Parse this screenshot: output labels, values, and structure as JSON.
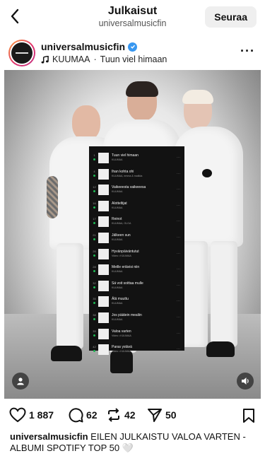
{
  "header": {
    "title": "Julkaisut",
    "subtitle": "universalmusicfin",
    "follow_label": "Seuraa"
  },
  "post": {
    "username": "universalmusicfin",
    "verified": true,
    "music_artist": "KUUMAA",
    "music_separator": "·",
    "music_track": "Tuun viel himaan"
  },
  "playlist": {
    "tracks": [
      {
        "num": "1",
        "title": "Tuun viel himaan",
        "sub": "KUUMAA"
      },
      {
        "num": "4",
        "title": "Ihan kohta ohi",
        "sub": "KUUMAA, emma & matilda"
      },
      {
        "num": "12",
        "title": "Vaikeeesta vaikeeesa",
        "sub": "KUUMAA"
      },
      {
        "num": "16",
        "title": "Alotteltijat",
        "sub": "KUUMAA"
      },
      {
        "num": "17",
        "title": "Reinot",
        "sub": "KUUMAA, OLGA"
      },
      {
        "num": "21",
        "title": "Jälkeen sun",
        "sub": "KUUMAA"
      },
      {
        "num": "26",
        "title": "Hyvänpäiväntutut",
        "sub": "Video • KUUMAA"
      },
      {
        "num": "28",
        "title": "Meille eriävisi niin",
        "sub": "KUUMAA"
      },
      {
        "num": "32",
        "title": "Sä voit soittaa mulle",
        "sub": "KUUMAA"
      },
      {
        "num": "35",
        "title": "Älä muuttu",
        "sub": "KUUMAA"
      },
      {
        "num": "38",
        "title": "Jos päätein mealiin",
        "sub": "KUUMAA"
      },
      {
        "num": "39",
        "title": "Valoa varten",
        "sub": "Video • KUUMAA"
      },
      {
        "num": "42",
        "title": "Paras ystävä",
        "sub": "Video • KUUMAA"
      }
    ],
    "more_glyph": "···"
  },
  "actions": {
    "likes": "1 887",
    "comments": "62",
    "reposts": "42",
    "shares": "50"
  },
  "caption": {
    "username": "universalmusicfin",
    "text": "EILEN JULKAISTU VALOA VARTEN -ALBUMI SPOTIFY TOP 50",
    "emoji": "🤍"
  },
  "icons": {
    "back": "chevron-left-icon",
    "more": "more-horizontal-icon",
    "music": "music-note-icon",
    "like": "heart-icon",
    "comment": "comment-icon",
    "repost": "repost-icon",
    "share": "send-icon",
    "save": "bookmark-icon",
    "user_tag": "person-icon",
    "mute": "speaker-icon"
  },
  "colors": {
    "verified": "#3897f0",
    "follow_bg": "#efefef",
    "playlist_bg": "#121212"
  }
}
